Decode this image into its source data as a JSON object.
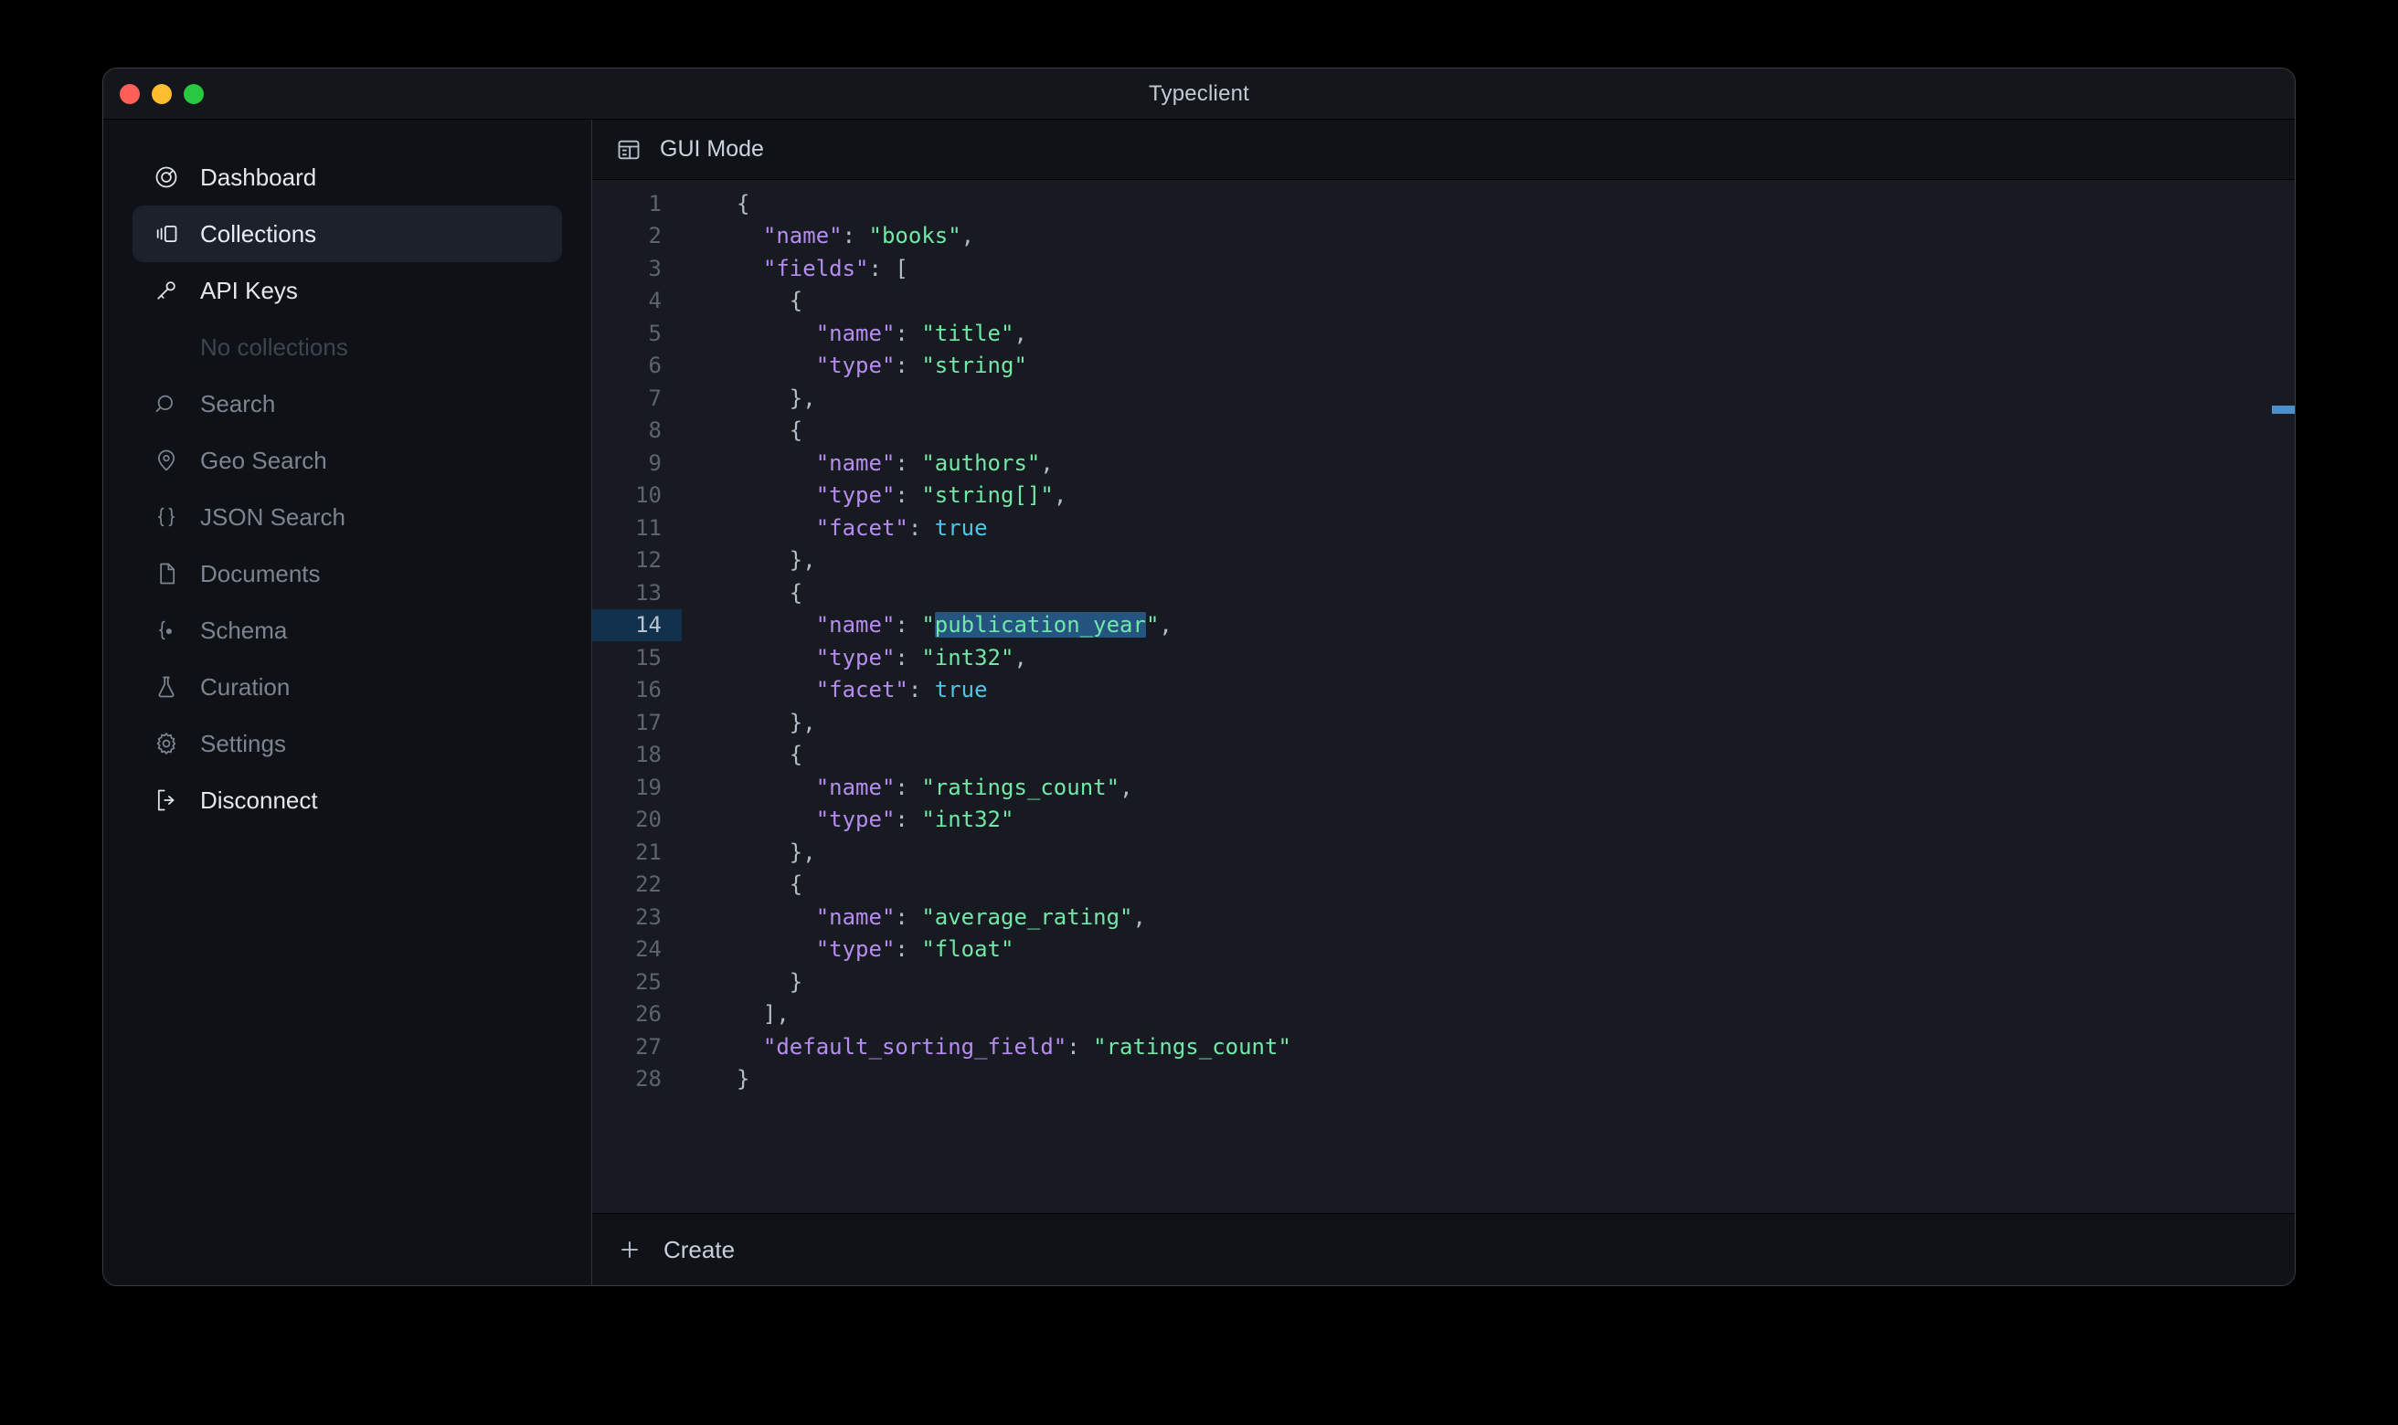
{
  "window": {
    "title": "Typeclient",
    "controls": [
      {
        "name": "close",
        "color": "#ff5f57"
      },
      {
        "name": "minimize",
        "color": "#febc2e"
      },
      {
        "name": "maximize",
        "color": "#28c840"
      }
    ]
  },
  "sidebar": {
    "items": [
      {
        "label": "Dashboard",
        "icon": "gauge-icon",
        "state": "bright"
      },
      {
        "label": "Collections",
        "icon": "collections-icon",
        "state": "active"
      },
      {
        "label": "API Keys",
        "icon": "key-icon",
        "state": "bright"
      },
      {
        "label": "Search",
        "icon": "search-icon",
        "state": "dim"
      },
      {
        "label": "Geo Search",
        "icon": "map-pin-icon",
        "state": "dim"
      },
      {
        "label": "JSON Search",
        "icon": "braces-icon",
        "state": "dim"
      },
      {
        "label": "Documents",
        "icon": "document-icon",
        "state": "dim"
      },
      {
        "label": "Schema",
        "icon": "schema-icon",
        "state": "dim"
      },
      {
        "label": "Curation",
        "icon": "flask-icon",
        "state": "dim"
      },
      {
        "label": "Settings",
        "icon": "gear-icon",
        "state": "dim"
      },
      {
        "label": "Disconnect",
        "icon": "logout-icon",
        "state": "bright"
      }
    ],
    "empty_state": "No collections"
  },
  "main": {
    "mode_label": "GUI Mode",
    "mode_icon": "gui-layout-icon",
    "create_label": "Create",
    "create_icon": "plus-icon"
  },
  "editor": {
    "highlighted_line": 14,
    "selection_text": "publication_year",
    "colors": {
      "background": "#171a20",
      "key": "#b78cf0",
      "string": "#72e8a8",
      "boolean": "#4ec5e8",
      "punctuation": "#b4bcc7",
      "line_number": "#5d646e",
      "active_gutter": "#12314c",
      "selection": "#265481",
      "overview_marker": "#4b8ec9"
    },
    "lines": [
      {
        "n": 1,
        "tokens": [
          {
            "t": "pun",
            "v": "{"
          }
        ],
        "indent": 0
      },
      {
        "n": 2,
        "tokens": [
          {
            "t": "key",
            "v": "\"name\""
          },
          {
            "t": "pun",
            "v": ": "
          },
          {
            "t": "str",
            "v": "\"books\""
          },
          {
            "t": "pun",
            "v": ","
          }
        ],
        "indent": 1
      },
      {
        "n": 3,
        "tokens": [
          {
            "t": "key",
            "v": "\"fields\""
          },
          {
            "t": "pun",
            "v": ": ["
          }
        ],
        "indent": 1
      },
      {
        "n": 4,
        "tokens": [
          {
            "t": "pun",
            "v": "{"
          }
        ],
        "indent": 2
      },
      {
        "n": 5,
        "tokens": [
          {
            "t": "key",
            "v": "\"name\""
          },
          {
            "t": "pun",
            "v": ": "
          },
          {
            "t": "str",
            "v": "\"title\""
          },
          {
            "t": "pun",
            "v": ","
          }
        ],
        "indent": 3
      },
      {
        "n": 6,
        "tokens": [
          {
            "t": "key",
            "v": "\"type\""
          },
          {
            "t": "pun",
            "v": ": "
          },
          {
            "t": "str",
            "v": "\"string\""
          }
        ],
        "indent": 3
      },
      {
        "n": 7,
        "tokens": [
          {
            "t": "pun",
            "v": "},"
          }
        ],
        "indent": 2
      },
      {
        "n": 8,
        "tokens": [
          {
            "t": "pun",
            "v": "{"
          }
        ],
        "indent": 2
      },
      {
        "n": 9,
        "tokens": [
          {
            "t": "key",
            "v": "\"name\""
          },
          {
            "t": "pun",
            "v": ": "
          },
          {
            "t": "str",
            "v": "\"authors\""
          },
          {
            "t": "pun",
            "v": ","
          }
        ],
        "indent": 3
      },
      {
        "n": 10,
        "tokens": [
          {
            "t": "key",
            "v": "\"type\""
          },
          {
            "t": "pun",
            "v": ": "
          },
          {
            "t": "str",
            "v": "\"string[]\""
          },
          {
            "t": "pun",
            "v": ","
          }
        ],
        "indent": 3
      },
      {
        "n": 11,
        "tokens": [
          {
            "t": "key",
            "v": "\"facet\""
          },
          {
            "t": "pun",
            "v": ": "
          },
          {
            "t": "bool",
            "v": "true"
          }
        ],
        "indent": 3
      },
      {
        "n": 12,
        "tokens": [
          {
            "t": "pun",
            "v": "},"
          }
        ],
        "indent": 2
      },
      {
        "n": 13,
        "tokens": [
          {
            "t": "pun",
            "v": "{"
          }
        ],
        "indent": 2
      },
      {
        "n": 14,
        "tokens": [
          {
            "t": "key",
            "v": "\"name\""
          },
          {
            "t": "pun",
            "v": ": "
          },
          {
            "t": "str",
            "v": "\""
          },
          {
            "t": "str sel",
            "v": "publication_year"
          },
          {
            "t": "str",
            "v": "\""
          },
          {
            "t": "pun",
            "v": ","
          }
        ],
        "indent": 3
      },
      {
        "n": 15,
        "tokens": [
          {
            "t": "key",
            "v": "\"type\""
          },
          {
            "t": "pun",
            "v": ": "
          },
          {
            "t": "str",
            "v": "\"int32\""
          },
          {
            "t": "pun",
            "v": ","
          }
        ],
        "indent": 3
      },
      {
        "n": 16,
        "tokens": [
          {
            "t": "key",
            "v": "\"facet\""
          },
          {
            "t": "pun",
            "v": ": "
          },
          {
            "t": "bool",
            "v": "true"
          }
        ],
        "indent": 3
      },
      {
        "n": 17,
        "tokens": [
          {
            "t": "pun",
            "v": "},"
          }
        ],
        "indent": 2
      },
      {
        "n": 18,
        "tokens": [
          {
            "t": "pun",
            "v": "{"
          }
        ],
        "indent": 2
      },
      {
        "n": 19,
        "tokens": [
          {
            "t": "key",
            "v": "\"name\""
          },
          {
            "t": "pun",
            "v": ": "
          },
          {
            "t": "str",
            "v": "\"ratings_count\""
          },
          {
            "t": "pun",
            "v": ","
          }
        ],
        "indent": 3
      },
      {
        "n": 20,
        "tokens": [
          {
            "t": "key",
            "v": "\"type\""
          },
          {
            "t": "pun",
            "v": ": "
          },
          {
            "t": "str",
            "v": "\"int32\""
          }
        ],
        "indent": 3
      },
      {
        "n": 21,
        "tokens": [
          {
            "t": "pun",
            "v": "},"
          }
        ],
        "indent": 2
      },
      {
        "n": 22,
        "tokens": [
          {
            "t": "pun",
            "v": "{"
          }
        ],
        "indent": 2
      },
      {
        "n": 23,
        "tokens": [
          {
            "t": "key",
            "v": "\"name\""
          },
          {
            "t": "pun",
            "v": ": "
          },
          {
            "t": "str",
            "v": "\"average_rating\""
          },
          {
            "t": "pun",
            "v": ","
          }
        ],
        "indent": 3
      },
      {
        "n": 24,
        "tokens": [
          {
            "t": "key",
            "v": "\"type\""
          },
          {
            "t": "pun",
            "v": ": "
          },
          {
            "t": "str",
            "v": "\"float\""
          }
        ],
        "indent": 3
      },
      {
        "n": 25,
        "tokens": [
          {
            "t": "pun",
            "v": "}"
          }
        ],
        "indent": 2
      },
      {
        "n": 26,
        "tokens": [
          {
            "t": "pun",
            "v": "],"
          }
        ],
        "indent": 1
      },
      {
        "n": 27,
        "tokens": [
          {
            "t": "key",
            "v": "\"default_sorting_field\""
          },
          {
            "t": "pun",
            "v": ": "
          },
          {
            "t": "str",
            "v": "\"ratings_count\""
          }
        ],
        "indent": 1
      },
      {
        "n": 28,
        "tokens": [
          {
            "t": "pun",
            "v": "}"
          }
        ],
        "indent": 0
      }
    ]
  }
}
